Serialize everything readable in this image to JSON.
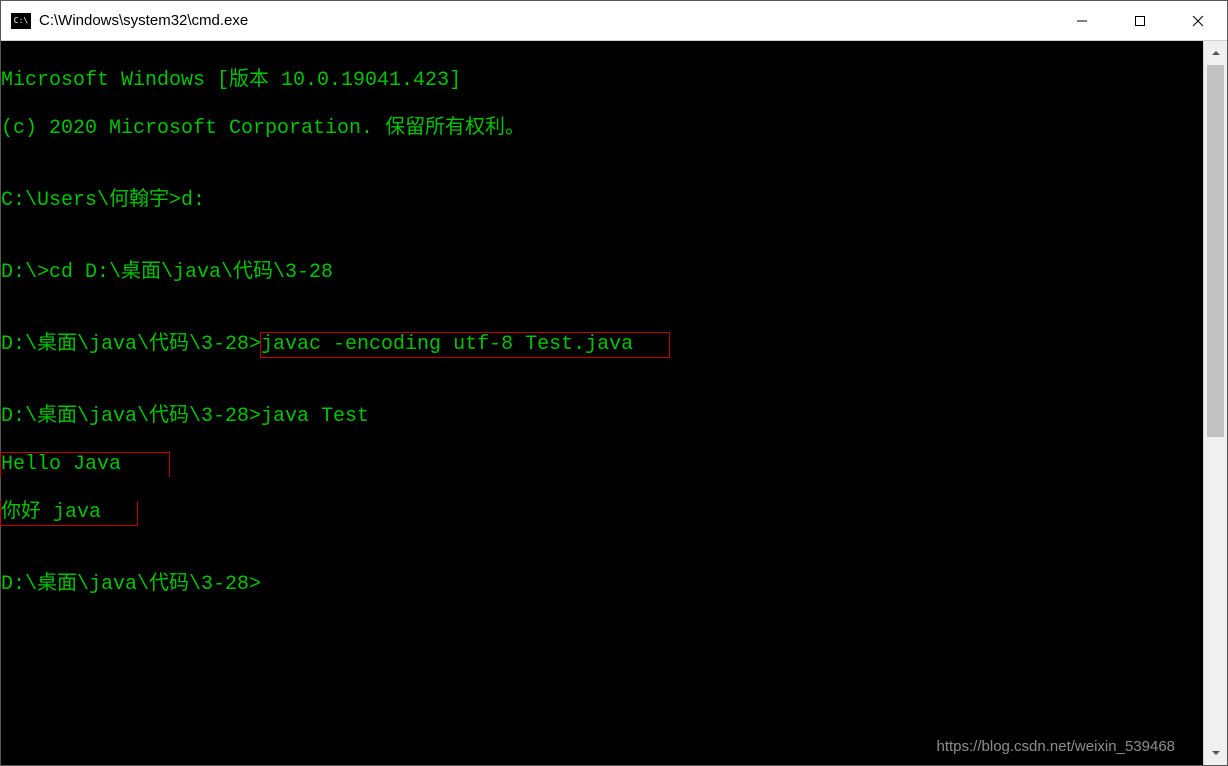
{
  "window": {
    "title": "C:\\Windows\\system32\\cmd.exe"
  },
  "terminal": {
    "header1": "Microsoft Windows [版本 10.0.19041.423]",
    "header2": "(c) 2020 Microsoft Corporation. 保留所有权利。",
    "blank": "",
    "line1_prompt": "C:\\Users\\何翰宇>",
    "line1_cmd": "d:",
    "line2_prompt": "D:\\>",
    "line2_cmd": "cd D:\\桌面\\java\\代码\\3-28",
    "line3_prompt": "D:\\桌面\\java\\代码\\3-28>",
    "line3_cmd": "javac -encoding utf-8 Test.java",
    "line4_prompt": "D:\\桌面\\java\\代码\\3-28>",
    "line4_cmd": "java Test",
    "out1": "Hello Java    ",
    "out2": "你好 java   ",
    "line5_prompt": "D:\\桌面\\java\\代码\\3-28>"
  },
  "watermark": "https://blog.csdn.net/weixin_539468"
}
